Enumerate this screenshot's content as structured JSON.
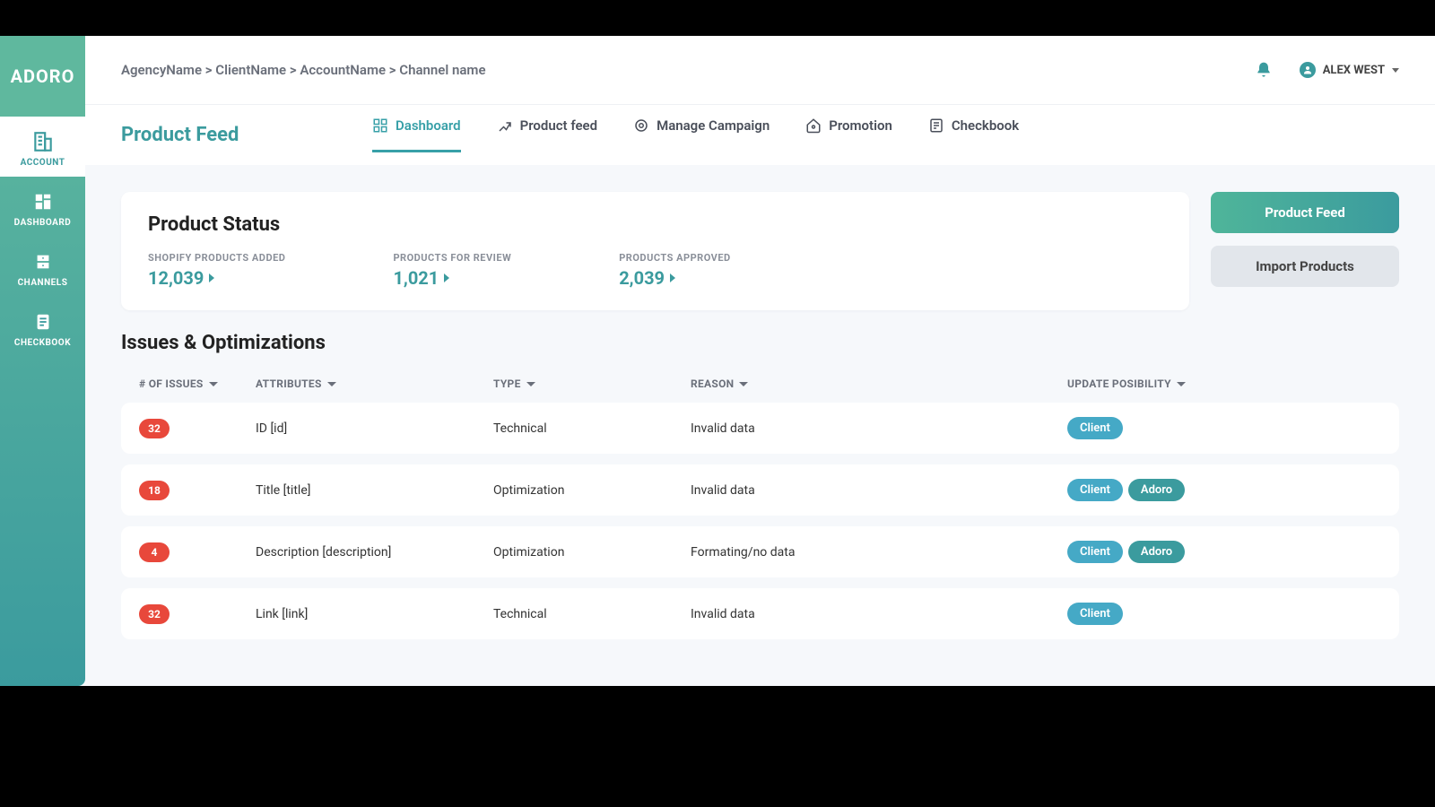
{
  "brand": "ADORO",
  "sidebar": {
    "items": [
      {
        "label": "ACCOUNT"
      },
      {
        "label": "DASHBOARD"
      },
      {
        "label": "CHANNELS"
      },
      {
        "label": "CHECKBOOK"
      }
    ]
  },
  "breadcrumb": "AgencyName > ClientName > AccountName > Channel name",
  "user": {
    "name": "ALEX WEST"
  },
  "pageTitle": "Product Feed",
  "tabs": [
    {
      "label": "Dashboard"
    },
    {
      "label": "Product feed"
    },
    {
      "label": "Manage Campaign"
    },
    {
      "label": "Promotion"
    },
    {
      "label": "Checkbook"
    }
  ],
  "status": {
    "title": "Product Status",
    "stats": [
      {
        "label": "SHOPIFY PRODUCTS ADDED",
        "value": "12,039"
      },
      {
        "label": "PRODUCTS FOR REVIEW",
        "value": "1,021"
      },
      {
        "label": "PRODUCTS APPROVED",
        "value": "2,039"
      }
    ]
  },
  "actions": {
    "primary": "Product Feed",
    "secondary": "Import Products"
  },
  "issues": {
    "title": "Issues & Optimizations",
    "columns": {
      "count": "# OF ISSUES",
      "attr": "ATTRIBUTES",
      "type": "TYPE",
      "reason": "REASON",
      "update": "UPDATE POSIBILITY"
    },
    "rows": [
      {
        "count": "32",
        "attr": "ID [id]",
        "type": "Technical",
        "reason": "Invalid data",
        "tags": [
          "Client"
        ]
      },
      {
        "count": "18",
        "attr": "Title [title]",
        "type": "Optimization",
        "reason": "Invalid data",
        "tags": [
          "Client",
          "Adoro"
        ]
      },
      {
        "count": "4",
        "attr": "Description [description]",
        "type": "Optimization",
        "reason": "Formating/no data",
        "tags": [
          "Client",
          "Adoro"
        ]
      },
      {
        "count": "32",
        "attr": "Link [link]",
        "type": "Technical",
        "reason": "Invalid data",
        "tags": [
          "Client"
        ]
      }
    ]
  }
}
